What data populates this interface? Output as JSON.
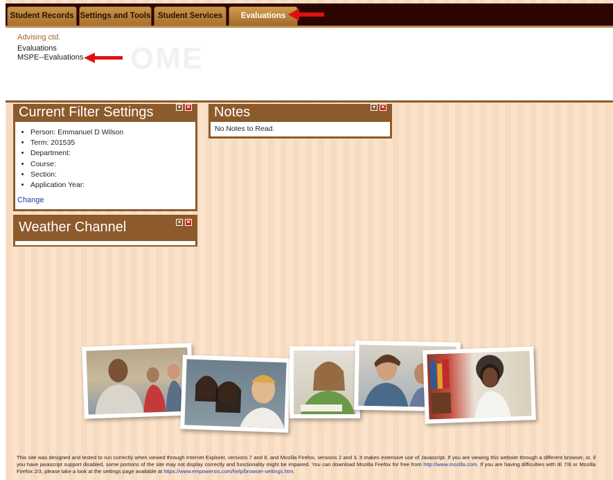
{
  "nav": {
    "tabs": [
      {
        "label": "Student Records"
      },
      {
        "label": "Settings and Tools"
      },
      {
        "label": "Student Services"
      },
      {
        "label": "Evaluations"
      }
    ]
  },
  "menu": {
    "header": "Advising ctd.",
    "items": [
      "Evaluations",
      "MSPE--Evaluations"
    ],
    "watermark": "OME"
  },
  "widgets": {
    "filter": {
      "title": "Current Filter Settings",
      "items": [
        "Person: Emmanuel D Wilson",
        "Term: 201535",
        "Department:",
        "Course:",
        "Section:",
        "Application Year:"
      ],
      "change_label": "Change"
    },
    "notes": {
      "title": "Notes",
      "body": "No Notes to Read."
    },
    "weather": {
      "title": "Weather Channel"
    },
    "buttons": {
      "minimize": "▾",
      "close": "✕"
    }
  },
  "footer": {
    "part1": "This site was designed and tested to run correctly when viewed through Internet Explorer, versions 7 and 8, and Mozilla Firefox, versions 2 and 3. It makes extensive use of Javascript. If you are viewing this website through a different browser, or, if you have javascript support disabled, some portions of the site may not display correctly and functionality might be impaired. You can download Mozilla Firefox for free from ",
    "link1": "http://www.mozilla.com",
    "part2": ". If you are having difficulties with IE 7/8 or Mozilla Firefox 2/3, please take a look at the settings page available at ",
    "link2": "https://www.empowersis.com/help/browser-settings.htm",
    "part3": "."
  },
  "colors": {
    "nav_bar": "#2c0400",
    "tab": "#b07a36",
    "widget_header": "#8c5a2b",
    "link": "#1a3aa8",
    "annotation_arrow": "#dd1111",
    "background": "#fbe3cc"
  }
}
